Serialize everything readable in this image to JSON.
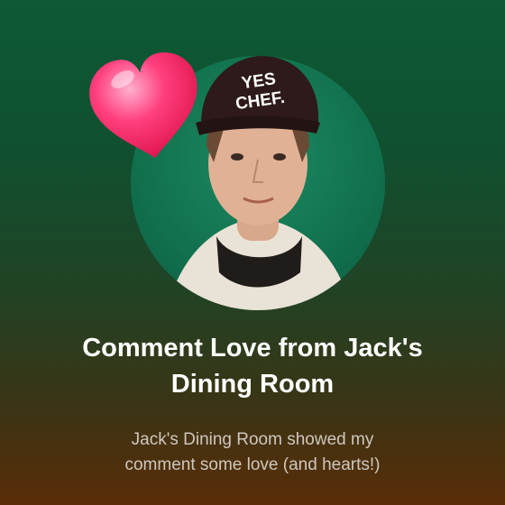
{
  "card": {
    "title": "Comment Love from Jack's\nDining Room",
    "subtitle": "Jack's Dining Room  showed my\ncomment some love (and hearts!)",
    "cap_text_line1": "YES",
    "cap_text_line2": "CHEF.",
    "accent_color": "#ff2f6a",
    "background_top": "#0d5a35",
    "background_bottom": "#5a2d08"
  }
}
